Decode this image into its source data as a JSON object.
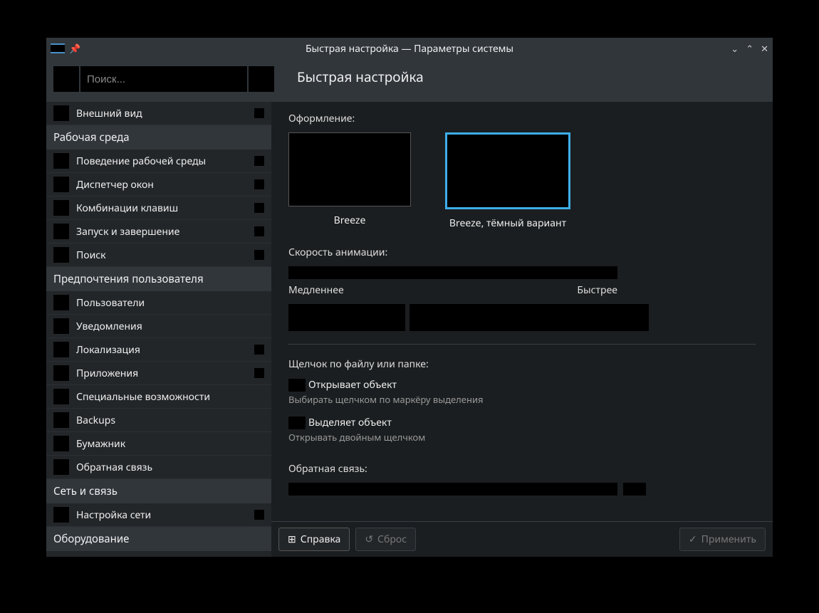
{
  "window": {
    "title": "Быстрая настройка — Параметры системы",
    "page_title": "Быстрая настройка"
  },
  "search": {
    "placeholder": "Поиск..."
  },
  "sidebar": {
    "top_item": "Внешний вид",
    "groups": [
      {
        "header": "Рабочая среда",
        "items": [
          {
            "label": "Поведение рабочей среды",
            "expandable": true
          },
          {
            "label": "Диспетчер окон",
            "expandable": true
          },
          {
            "label": "Комбинации клавиш",
            "expandable": true
          },
          {
            "label": "Запуск и завершение",
            "expandable": true
          },
          {
            "label": "Поиск",
            "expandable": true
          }
        ]
      },
      {
        "header": "Предпочтения пользователя",
        "items": [
          {
            "label": "Пользователи",
            "expandable": false
          },
          {
            "label": "Уведомления",
            "expandable": false
          },
          {
            "label": "Локализация",
            "expandable": true
          },
          {
            "label": "Приложения",
            "expandable": true
          },
          {
            "label": "Специальные возможности",
            "expandable": false
          },
          {
            "label": "Backups",
            "expandable": false
          },
          {
            "label": "Бумажник",
            "expandable": false
          },
          {
            "label": "Обратная связь",
            "expandable": false
          }
        ]
      },
      {
        "header": "Сеть и связь",
        "items": [
          {
            "label": "Настройка сети",
            "expandable": true
          }
        ]
      },
      {
        "header": "Оборудование",
        "items": []
      }
    ]
  },
  "content": {
    "theme_label": "Оформление:",
    "themes": [
      {
        "name": "Breeze",
        "selected": false
      },
      {
        "name": "Breeze, тёмный вариант",
        "selected": true
      }
    ],
    "anim_speed_label": "Скорость анимации:",
    "anim_slow": "Медленнее",
    "anim_fast": "Быстрее",
    "click_label": "Щелчок по файлу или папке:",
    "radio1": "Открывает объект",
    "radio1_hint": "Выбирать щелчком по маркёру выделения",
    "radio2": "Выделяет объект",
    "radio2_hint": "Открывать двойным щелчком",
    "feedback_label": "Обратная связь:"
  },
  "footer": {
    "help": "Справка",
    "reset": "Сброс",
    "apply": "Применить"
  }
}
